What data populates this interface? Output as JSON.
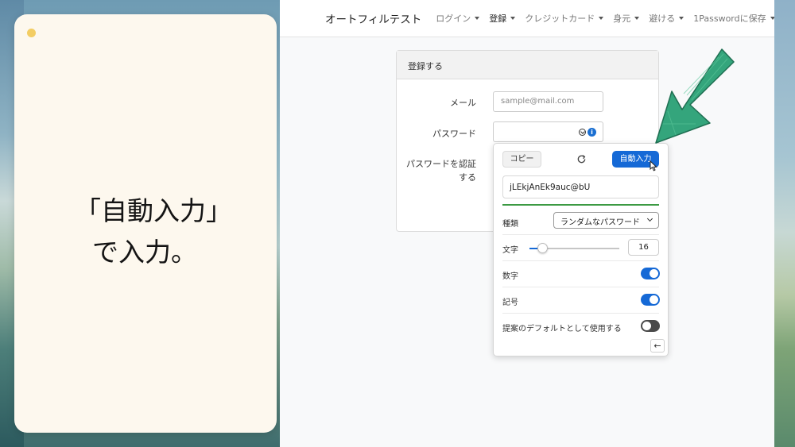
{
  "caption": {
    "line1": "「自動入力」",
    "line2": "で入力。"
  },
  "navbar": {
    "brand": "オートフィルテスト",
    "items": [
      {
        "label": "ログイン",
        "active": false
      },
      {
        "label": "登録",
        "active": true
      },
      {
        "label": "クレジットカード",
        "active": false
      },
      {
        "label": "身元",
        "active": false
      },
      {
        "label": "避ける",
        "active": false
      },
      {
        "label": "1Passwordに保存",
        "active": false
      }
    ]
  },
  "form": {
    "header": "登録する",
    "email_label": "メール",
    "email_placeholder": "sample@mail.com",
    "password_label": "パスワード",
    "confirm_label_line1": "パスワードを認証",
    "confirm_label_line2": "する"
  },
  "generator": {
    "copy_label": "コピー",
    "autofill_label": "自動入力",
    "generated_password": "jLEkjAnEk9auc@bU",
    "type_label": "種類",
    "type_value": "ランダムなパスワード",
    "chars_label": "文字",
    "length_value": "16",
    "length_fraction": 0.14,
    "numbers_label": "数字",
    "numbers_enabled": true,
    "symbols_label": "記号",
    "symbols_enabled": true,
    "default_label": "提案のデフォルトとして使用する",
    "default_enabled": false,
    "back_label": "←"
  },
  "colors": {
    "accent": "#1569d6",
    "strength": "#3c9a43",
    "arrow": "#2fa07a"
  },
  "icons": [
    "refresh-icon",
    "cursor-icon",
    "info-icon",
    "chevron-down-icon",
    "back-arrow-icon",
    "arrow-pointer-icon"
  ]
}
